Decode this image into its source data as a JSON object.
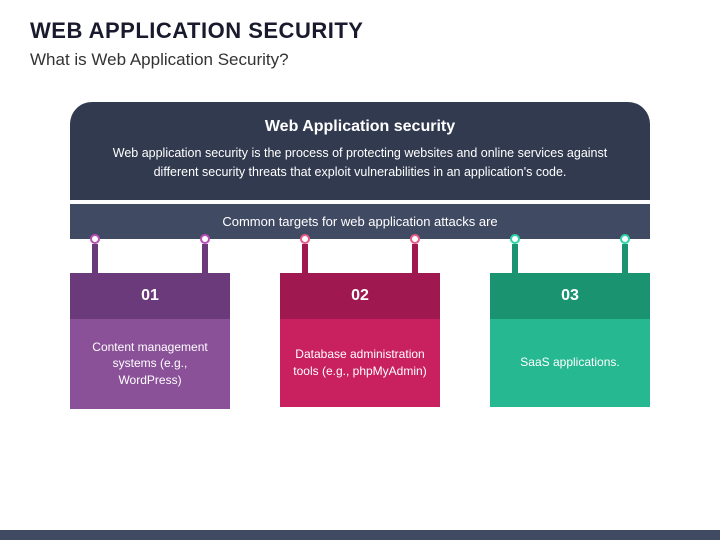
{
  "header": {
    "title": "WEB APPLICATION SECURITY",
    "subtitle": "What is Web Application Security?"
  },
  "infobox": {
    "title": "Web Application security",
    "description": "Web application security is the process of protecting websites and online services against different security threats that exploit vulnerabilities in an application's code."
  },
  "bar": {
    "text": "Common targets for web application attacks are"
  },
  "cards": [
    {
      "num": "01",
      "text": "Content management systems (e.g., WordPress)"
    },
    {
      "num": "02",
      "text": "Database administration tools (e.g., phpMyAdmin)"
    },
    {
      "num": "03",
      "text": "SaaS applications."
    }
  ]
}
